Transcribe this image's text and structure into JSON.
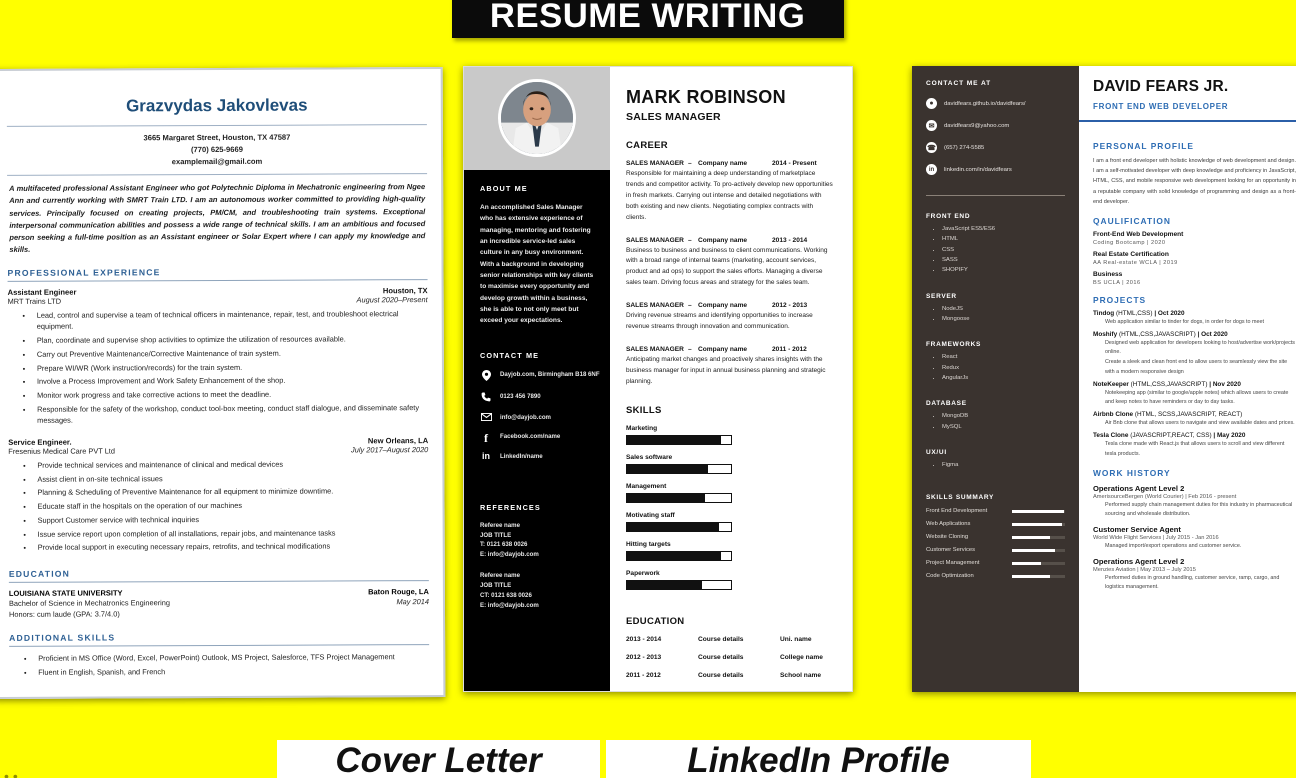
{
  "page": {
    "background_color": "#FFFF00",
    "title_banner": "RESUME WRITING",
    "bottom_labels": [
      "Cover Letter",
      "LinkedIn Profile"
    ],
    "bottom_dots": "••"
  },
  "resume1": {
    "name": "Grazvydas Jakovlevas",
    "contact": [
      "3665 Margaret Street, Houston, TX 47587",
      "(770) 625-9669",
      "examplemail@gmail.com"
    ],
    "summary": "A multifaceted professional Assistant Engineer who got Polytechnic Diploma in Mechatronic engineering from Ngee Ann and currently working with SMRT Train LTD. I am an autonomous worker committed to providing high-quality services. Principally focused on creating projects, PM/CM, and troubleshooting train systems. Exceptional interpersonal communication abilities and possess a wide range of technical skills. I am an ambitious and focused person seeking a full-time position as an Assistant engineer or Solar Expert where I can apply my knowledge and skills.",
    "sections": {
      "experience_title": "PROFESSIONAL EXPERIENCE",
      "education_title": "EDUCATION",
      "skills_title": "ADDITIONAL SKILLS"
    },
    "jobs": [
      {
        "title": "Assistant Engineer",
        "company": "MRT Trains LTD",
        "location": "Houston, TX",
        "dates": "August 2020–Present",
        "bullets": [
          "Lead, control and supervise a team of technical officers in maintenance, repair, test, and troubleshoot electrical equipment.",
          "Plan, coordinate and supervise shop activities to optimize the utilization of resources available.",
          "Carry out Preventive Maintenance/Corrective Maintenance of train system.",
          "Prepare WI/WR (Work instruction/records) for the train system.",
          "Involve a Process Improvement and Work Safety Enhancement of the shop.",
          "Monitor work progress and take corrective actions to meet the deadline.",
          "Responsible for the safety of the workshop, conduct tool-box meeting, conduct staff dialogue, and disseminate safety messages."
        ]
      },
      {
        "title": "Service Engineer.",
        "company": "Fresenius Medical Care PVT Ltd",
        "location": "New Orleans, LA",
        "dates": "July 2017–August 2020",
        "bullets": [
          "Provide technical services and maintenance of clinical and medical devices",
          "Assist client in on-site technical issues",
          "Planning & Scheduling of Preventive Maintenance for all equipment to minimize downtime.",
          "Educate staff in the hospitals on the operation of our machines",
          "Support Customer service with technical inquiries",
          "Issue service report upon completion of all installations, repair jobs, and maintenance tasks",
          "Provide local support in executing necessary repairs, retrofits, and technical modifications"
        ]
      }
    ],
    "education": {
      "school": "LOUISIANA STATE UNIVERSITY",
      "location": "Baton Rouge, LA",
      "degree": "Bachelor of Science in Mechatronics Engineering",
      "date": "May 2014",
      "honors": "Honors: cum laude (GPA: 3.7/4.0)"
    },
    "additional_skills": [
      "Proficient in MS Office (Word, Excel, PowerPoint) Outlook, MS Project, Salesforce, TFS Project Management",
      "Fluent in English, Spanish, and French"
    ]
  },
  "resume2": {
    "name": "MARK ROBINSON",
    "role": "SALES MANAGER",
    "about_title": "ABOUT ME",
    "about_text": "An accomplished Sales Manager who has extensive experience of managing, mentoring and fostering an incredible service-led sales culture in any busy environment. With a background in developing senior relationships with key clients to maximise every opportunity and develop growth within a business, she is able to not only meet but exceed your expectations.",
    "contact_title": "CONTACT ME",
    "contacts": [
      {
        "icon": "location-pin-icon",
        "glyph": "●",
        "text": "Dayjob.com, Birmingham B18 6NF"
      },
      {
        "icon": "phone-icon",
        "glyph": "☎",
        "text": "0123 456 7890"
      },
      {
        "icon": "email-icon",
        "glyph": "✉",
        "text": "info@dayjob.com"
      },
      {
        "icon": "facebook-icon",
        "glyph": "f",
        "text": "Facebook.com/name"
      },
      {
        "icon": "linkedin-icon",
        "glyph": "in",
        "text": "LinkedIn/name"
      }
    ],
    "references_title": "REFERENCES",
    "references": [
      [
        "Referee name",
        "JOB TITLE",
        "T: 0121 638 0026",
        "E: info@dayjob.com"
      ],
      [
        "Referee name",
        "JOB TITLE",
        "CT: 0121 638 0026",
        "E: info@dayjob.com"
      ]
    ],
    "career_title": "CAREER",
    "career": [
      {
        "role": "SALES MANAGER",
        "dash": "–",
        "company": "Company name",
        "dates": "2014 - Present",
        "desc": "Responsible for maintaining a deep understanding of marketplace trends and competitor activity. To pro-actively develop new opportunities in fresh markets. Carrying out intense and detailed negotiations with both existing and new clients. Negotiating complex contracts with clients."
      },
      {
        "role": "SALES MANAGER",
        "dash": "–",
        "company": "Company name",
        "dates": "2013 - 2014",
        "desc": "Business to business and business to client communications. Working with a broad range of internal teams (marketing, account services, product and ad ops) to support the sales efforts. Managing a diverse sales team. Driving focus areas and strategy for the sales team."
      },
      {
        "role": "SALES MANAGER",
        "dash": "–",
        "company": "Company name",
        "dates": "2012 - 2013",
        "desc": "Driving revenue streams and identifying opportunities to increase revenue streams through innovation and communication."
      },
      {
        "role": "SALES MANAGER",
        "dash": "–",
        "company": "Company name",
        "dates": "2011 - 2012",
        "desc": "Anticipating market changes and proactively shares insights with the business manager for input in annual business planning and strategic planning."
      }
    ],
    "skills_title": "SKILLS",
    "skills": [
      {
        "label": "Marketing",
        "percent": 90
      },
      {
        "label": "Sales software",
        "percent": 78
      },
      {
        "label": "Management",
        "percent": 75
      },
      {
        "label": "Motivating staff",
        "percent": 88
      },
      {
        "label": "Hitting targets",
        "percent": 90
      },
      {
        "label": "Paperwork",
        "percent": 72
      }
    ],
    "education_title": "EDUCATION",
    "education": [
      {
        "years": "2013 - 2014",
        "course": "Course details",
        "place": "Uni. name"
      },
      {
        "years": "2012 - 2013",
        "course": "Course details",
        "place": "College name"
      },
      {
        "years": "2011 - 2012",
        "course": "Course details",
        "place": "School name"
      }
    ]
  },
  "resume3": {
    "name": "DAVID FEARS JR.",
    "role": "FRONT END WEB DEVELOPER",
    "contact_title": "CONTACT ME AT",
    "contacts": [
      {
        "icon": "github-icon",
        "glyph": "●",
        "text": "davidfears.github.io/davidfears/"
      },
      {
        "icon": "email-icon",
        "glyph": "✉",
        "text": "davidfears9@yahoo.com"
      },
      {
        "icon": "phone-icon",
        "glyph": "☎",
        "text": "(657) 274-5585"
      },
      {
        "icon": "linkedin-icon",
        "glyph": "in",
        "text": "linkedin.com/in/davidfears"
      }
    ],
    "tech": [
      {
        "category": "FRONT END",
        "items": [
          "JavaScript ES5/ES6",
          "HTML",
          "CSS",
          "SASS",
          "SHOPIFY"
        ]
      },
      {
        "category": "SERVER",
        "items": [
          "NodeJS",
          "Mongoose"
        ]
      },
      {
        "category": "FRAMEWORKS",
        "items": [
          "React",
          "Redux",
          "AngularJs"
        ]
      },
      {
        "category": "DATABASE",
        "items": [
          "MongoDB",
          "MySQL"
        ]
      },
      {
        "category": "UX/UI",
        "items": [
          "Figma"
        ]
      }
    ],
    "skills_summary_title": "SKILLS SUMMARY",
    "skills_summary": [
      {
        "label": "Front End Development",
        "percent": 98
      },
      {
        "label": "Web Applications",
        "percent": 95
      },
      {
        "label": "Website Cloning",
        "percent": 72
      },
      {
        "label": "Customer Services",
        "percent": 82
      },
      {
        "label": "Project Management",
        "percent": 55
      },
      {
        "label": "Code Optimization",
        "percent": 72
      }
    ],
    "profile_title": "PERSONAL PROFILE",
    "profile_text": "I am a front end developer with holistic knowledge of web development and design. I am a self-motivated developer with deep knowledge and proficiency in JavaScript, HTML, CSS, and mobile responsive web development looking for an opportunity in a reputable company with solid knowledge of programming and design as a front-end developer.",
    "qualification_title": "QAULIFICATION",
    "qualifications": [
      {
        "title": "Front-End Web Development",
        "sub": "Coding Bootcamp | 2020"
      },
      {
        "title": "Real Estate Certification",
        "sub": "AA Real-estate WCLA | 2019"
      },
      {
        "title": "Business",
        "sub": "BS UCLA | 2016"
      }
    ],
    "projects_title": "PROJECTS",
    "projects": [
      {
        "name": "Tindog",
        "tech": "(HTML,CSS)",
        "date": "| Oct 2020",
        "bullets": [
          "Web application similar to tinder for dogs, in order for dogs to meet"
        ]
      },
      {
        "name": "Moshify",
        "tech": "(HTML,CSS,JAVASCRIPT)",
        "date": "| Oct 2020",
        "bullets": [
          "Designed web application for developers looking to host/advertise work/projects online.",
          "Create a sleek and clean front end to allow users to seamlessly view the site with a modern responsive design"
        ]
      },
      {
        "name": "NoteKeeper",
        "tech": "(HTML,CSS,JAVASCRIPT)",
        "date": "| Nov 2020",
        "bullets": [
          "Notekeeping app (similar to google/apple notes) which allows users to create and keep notes to have reminders or day to day tasks."
        ]
      },
      {
        "name": "Airbnb Clone",
        "tech": "(HTML, SCSS,JAVASCRIPT, REACT)",
        "date": "",
        "bullets": [
          "Air Bnb clone that allows users to navigate and view available dates and prices."
        ]
      },
      {
        "name": "Tesla Clone",
        "tech": "(JAVASCRIPT,REACT, CSS)",
        "date": "| May 2020",
        "bullets": [
          "Tesla clone made with React.js that allows users to scroll and view different tesla products."
        ]
      }
    ],
    "work_title": "WORK HISTORY",
    "work": [
      {
        "title": "Operations Agent Level 2",
        "sub": "AmerisourceBergen (World Courier) | Feb 2016 - present",
        "bullets": [
          "Performed supply chain management duties for this industry in pharmaceutical sourcing and wholesale distribution."
        ]
      },
      {
        "title": "Customer Service Agent",
        "sub": "World Wide Flight Services  | July 2015 - Jan 2016",
        "bullets": [
          "Managed import/export operations and customer service."
        ]
      },
      {
        "title": "Operations Agent Level 2",
        "sub": "Menzies Aviation | May 2013 – July 2015",
        "bullets": [
          "Performed duties in ground handling, customer service, ramp, cargo, and logistics management."
        ]
      }
    ]
  }
}
